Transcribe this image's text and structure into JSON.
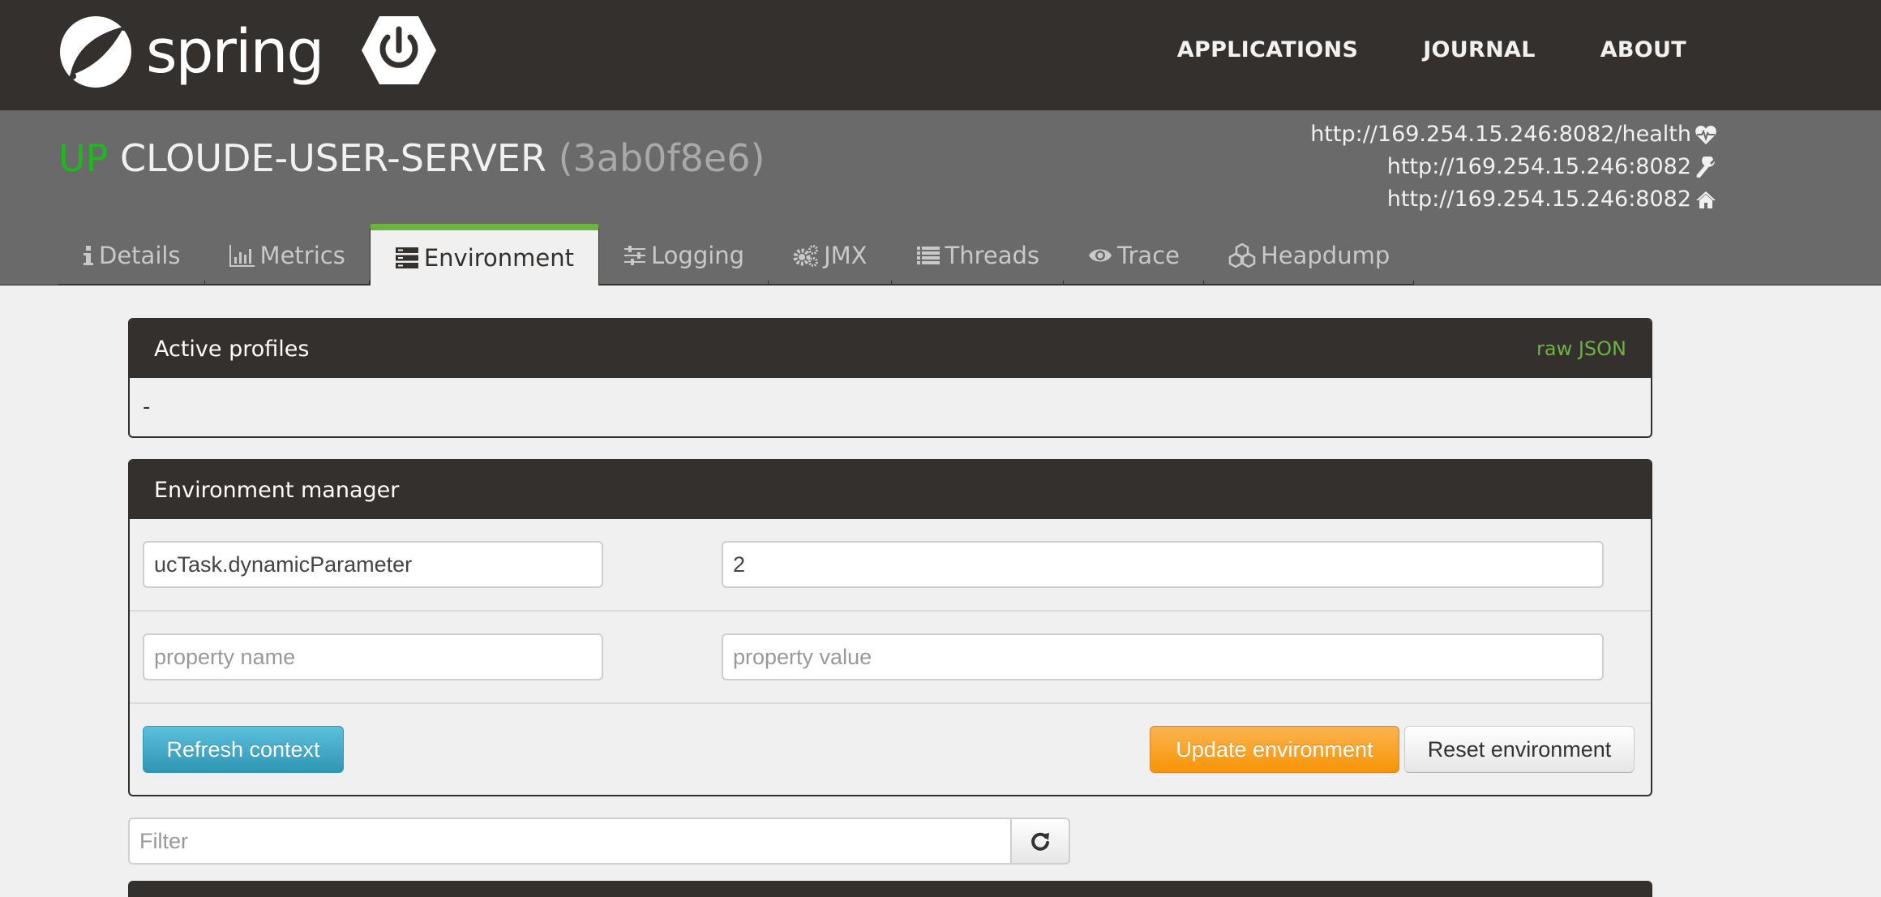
{
  "navbar": {
    "brand_text": "spring",
    "links": [
      {
        "label": "APPLICATIONS"
      },
      {
        "label": "JOURNAL"
      },
      {
        "label": "ABOUT"
      }
    ]
  },
  "app": {
    "status": "UP",
    "name": "CLOUDE-USER-SERVER",
    "id": "(3ab0f8e6)",
    "status_color": "#1eb91e",
    "urls": [
      {
        "text": "http://169.254.15.246:8082/health",
        "icon": "heartbeat-icon"
      },
      {
        "text": "http://169.254.15.246:8082",
        "icon": "wrench-icon"
      },
      {
        "text": "http://169.254.15.246:8082",
        "icon": "home-icon"
      }
    ]
  },
  "tabs": [
    {
      "label": "Details",
      "icon": "info-icon",
      "active": false
    },
    {
      "label": "Metrics",
      "icon": "bar-chart-icon",
      "active": false
    },
    {
      "label": "Environment",
      "icon": "server-icon",
      "active": true
    },
    {
      "label": "Logging",
      "icon": "sliders-icon",
      "active": false
    },
    {
      "label": "JMX",
      "icon": "gears-icon",
      "active": false
    },
    {
      "label": "Threads",
      "icon": "list-icon",
      "active": false
    },
    {
      "label": "Trace",
      "icon": "eye-icon",
      "active": false
    },
    {
      "label": "Heapdump",
      "icon": "cubes-icon",
      "active": false
    }
  ],
  "active_profiles": {
    "title": "Active profiles",
    "raw_json_link": "raw JSON",
    "value": "-"
  },
  "environment_manager": {
    "title": "Environment manager",
    "rows": [
      {
        "name": "ucTask.dynamicParameter",
        "value": "2"
      }
    ],
    "new_row": {
      "name_placeholder": "property name",
      "value_placeholder": "property value"
    },
    "refresh_button": "Refresh context",
    "update_button": "Update environment",
    "reset_button": "Reset environment"
  },
  "filter": {
    "placeholder": "Filter",
    "value": ""
  },
  "colors": {
    "brand_dark": "#34302d",
    "accent_green": "#6db33f",
    "header_gray": "#6a6a6a"
  }
}
